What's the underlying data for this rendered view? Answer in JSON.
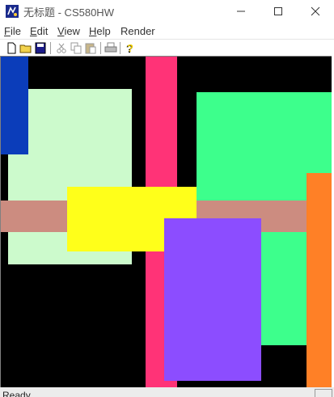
{
  "window": {
    "title": "无标题 - CS580HW",
    "buttons": {
      "minimize": "minimize-icon",
      "maximize": "maximize-icon",
      "close": "close-icon"
    }
  },
  "menu": [
    {
      "label": "File",
      "mnemonic": "F",
      "rest": "ile"
    },
    {
      "label": "Edit",
      "mnemonic": "E",
      "rest": "dit"
    },
    {
      "label": "View",
      "mnemonic": "V",
      "rest": "iew"
    },
    {
      "label": "Help",
      "mnemonic": "H",
      "rest": "elp"
    },
    {
      "label": "Render",
      "mnemonic": "",
      "rest": "Render"
    }
  ],
  "toolbar": [
    "new-file-icon",
    "open-folder-icon",
    "save-disk-icon",
    "cut-scissors-icon",
    "copy-icon",
    "paste-icon",
    "print-icon",
    "help-question-icon"
  ],
  "canvas": {
    "background": "#000000",
    "rectangles": [
      {
        "name": "pale-green-rect",
        "color": "#CCFACC"
      },
      {
        "name": "blue-rect",
        "color": "#0B3DBA"
      },
      {
        "name": "pink-vertical-bar",
        "color": "#FF3377"
      },
      {
        "name": "green-rect",
        "color": "#3DFF8C"
      },
      {
        "name": "rose-horizontal-bar",
        "color": "#CC8C80"
      },
      {
        "name": "yellow-rect",
        "color": "#FFFF1A"
      },
      {
        "name": "purple-rect",
        "color": "#8C4DFF"
      },
      {
        "name": "orange-rect",
        "color": "#FF8026"
      }
    ]
  },
  "status": {
    "text": "Ready"
  }
}
